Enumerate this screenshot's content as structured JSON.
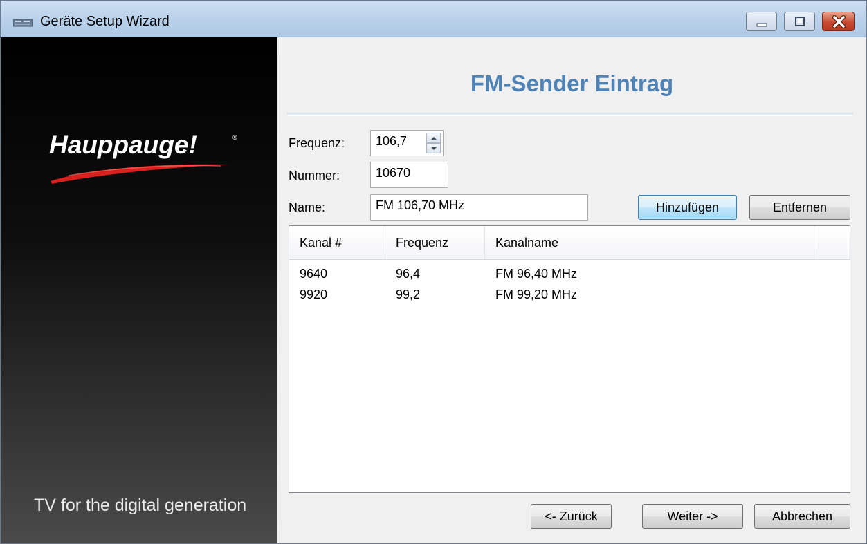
{
  "window": {
    "title": "Geräte Setup Wizard"
  },
  "sidebar": {
    "logo_text": "Hauppauge!",
    "tagline": "TV for the digital generation"
  },
  "page": {
    "title": "FM-Sender Eintrag"
  },
  "form": {
    "frequenz_label": "Frequenz:",
    "frequenz_value": "106,7",
    "nummer_label": "Nummer:",
    "nummer_value": "10670",
    "name_label": "Name:",
    "name_value": "FM 106,70 MHz",
    "add_button": "Hinzufügen",
    "remove_button": "Entfernen"
  },
  "channel_list": {
    "columns": [
      "Kanal #",
      "Frequenz",
      "Kanalname",
      ""
    ],
    "rows": [
      {
        "kanal": "9640",
        "frequenz": "96,4",
        "kanalname": "FM 96,40 MHz"
      },
      {
        "kanal": "9920",
        "frequenz": "99,2",
        "kanalname": "FM 99,20 MHz"
      }
    ]
  },
  "footer": {
    "back_button": "<- Zurück",
    "next_button": "Weiter ->",
    "cancel_button": "Abbrechen"
  },
  "colors": {
    "title_accent": "#4f82b5",
    "logo_swoosh": "#d8201f"
  },
  "icons": {
    "app": "tv-tuner-icon",
    "minimize": "minimize-icon",
    "maximize": "maximize-icon",
    "close": "close-icon",
    "spin_up": "chevron-up-icon",
    "spin_down": "chevron-down-icon"
  }
}
